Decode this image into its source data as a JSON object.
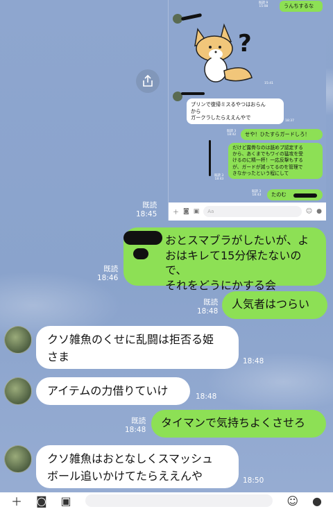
{
  "embedded": {
    "read_top": "既読 9",
    "time_top": "15:08",
    "bubble_top": "うんちするな",
    "sticker_question": "?",
    "sticker_time": "15:41",
    "white_bubble": "プリンで復帰ミスるやつはおらん\nから\nガークラしたらええんやで",
    "white_time": "18:37",
    "read_1": "既読 3",
    "time_1": "18:42",
    "bubble_1": "せや！ひたすらガードしろ！",
    "read_2": "既読 3",
    "time_2": "18:43",
    "bubble_2": "だけど露骨なのは舐めプ認定する\nから、あくまでもワイの猛攻を受\nけるのに精一杯！一応反撃もする\nが、ガードが減ってるのを管理で\nきなかったという程にして",
    "read_3": "既読 3",
    "time_3": "18:43",
    "bubble_3": "たのむ",
    "input_placeholder": "Aa"
  },
  "messages": [
    {
      "side": "right",
      "read": "既読",
      "time": "18:45",
      "text": ""
    },
    {
      "side": "right",
      "read": "既読",
      "time": "18:46",
      "text": "おとスマブラがしたいが、よ\nおはキレて15分保たないので、\nそれをどうにかする会"
    },
    {
      "side": "right",
      "read": "既読",
      "time": "18:48",
      "text": "人気者はつらい"
    },
    {
      "side": "left",
      "time": "18:48",
      "text": "クソ雑魚のくせに乱闘は拒否る姫\nさま"
    },
    {
      "side": "left",
      "time": "18:48",
      "text": "アイテムの力借りていけ"
    },
    {
      "side": "right",
      "read": "既読",
      "time": "18:48",
      "text": "タイマンで気持ちよくさせろ"
    },
    {
      "side": "left",
      "time": "18:50",
      "text": "クソ雑魚はおとなしくスマッシュ\nボール追いかけてたらええんや"
    }
  ]
}
